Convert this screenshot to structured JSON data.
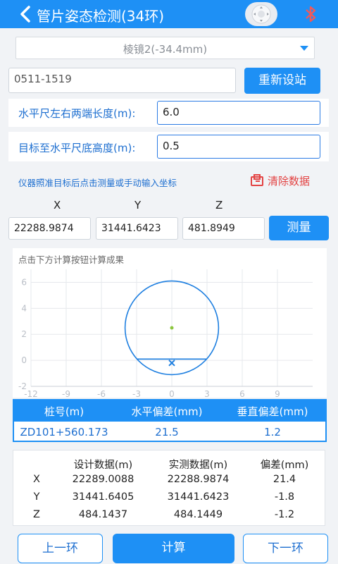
{
  "header": {
    "title": "管片姿态检测(34环)"
  },
  "prism_select": {
    "value": "棱镜2(-34.4mm)"
  },
  "station": {
    "value": "0511-1519",
    "reset_label": "重新设站"
  },
  "ruler_length": {
    "label": "水平尺左右两端长度(m):",
    "value": "6.0"
  },
  "target_height": {
    "label": "目标至水平尺底高度(m):",
    "value": "0.5"
  },
  "measure_section": {
    "hint": "仪器照准目标后点击测量或手动输入坐标",
    "clear_label": "清除数据",
    "x_label": "X",
    "y_label": "Y",
    "z_label": "Z",
    "x_value": "22288.9874",
    "y_value": "31441.6423",
    "z_value": "481.8949",
    "measure_label": "测量"
  },
  "chart_data": {
    "type": "scatter",
    "caption": "点击下方计算按钮计算成果",
    "xlim": [
      -12,
      12
    ],
    "ylim": [
      -2,
      7
    ],
    "x_ticks": [
      -12,
      -9,
      -6,
      -3,
      0,
      3,
      6,
      9
    ],
    "y_ticks": [
      6,
      4,
      2,
      0,
      -2
    ],
    "grid": true,
    "circle_center": [
      0,
      2.5
    ],
    "circle_radius": 3.6,
    "chord_y": 0.1,
    "center_point": [
      0,
      2.5
    ],
    "target_point": [
      0,
      -0.2
    ]
  },
  "deviation_table": {
    "headers": [
      "桩号(m)",
      "水平偏差(mm)",
      "垂直偏差(mm)"
    ],
    "row": [
      "ZD101+560.173",
      "21.5",
      "1.2"
    ]
  },
  "compare_table": {
    "headers": [
      "",
      "设计数据(m)",
      "实测数据(m)",
      "偏差(mm)"
    ],
    "rows": [
      [
        "X",
        "22289.0088",
        "22288.9874",
        "21.4"
      ],
      [
        "Y",
        "31441.6405",
        "31441.6423",
        "-1.8"
      ],
      [
        "Z",
        "484.1437",
        "484.1449",
        "-1.2"
      ]
    ]
  },
  "footer": {
    "prev_label": "上一环",
    "calc_label": "计算",
    "next_label": "下一环"
  },
  "colors": {
    "primary": "#1e90f5",
    "danger": "#e34343",
    "point": "#8cc63f"
  }
}
